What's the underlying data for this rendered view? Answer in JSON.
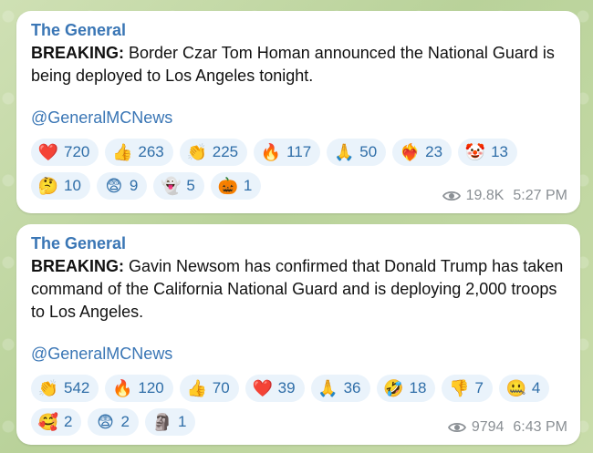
{
  "messages": [
    {
      "sender": "The General",
      "breaking_label": "BREAKING:",
      "body": " Border Czar Tom Homan announced the National Guard is being deployed to Los Angeles tonight.",
      "link": "@GeneralMCNews",
      "reactions": [
        {
          "emoji": "❤️",
          "icon": "red-heart-icon",
          "count": "720"
        },
        {
          "emoji": "👍",
          "icon": "thumbs-up-icon",
          "count": "263"
        },
        {
          "emoji": "👏",
          "icon": "clapping-hands-icon",
          "count": "225"
        },
        {
          "emoji": "🔥",
          "icon": "fire-icon",
          "count": "117"
        },
        {
          "emoji": "🙏",
          "icon": "praying-hands-icon",
          "count": "50"
        },
        {
          "emoji": "❤️‍🔥",
          "icon": "heart-on-fire-icon",
          "count": "23"
        },
        {
          "emoji": "🤡",
          "icon": "clown-face-icon",
          "count": "13"
        },
        {
          "emoji": "🤔",
          "icon": "thinking-face-icon",
          "count": "10"
        },
        {
          "emoji": "😨",
          "icon": "fearful-face-icon",
          "count": "9"
        },
        {
          "emoji": "👻",
          "icon": "ghost-icon",
          "count": "5"
        },
        {
          "emoji": "🎃",
          "icon": "jack-o-lantern-icon",
          "count": "1"
        }
      ],
      "views": "19.8K",
      "time": "5:27 PM"
    },
    {
      "sender": "The General",
      "breaking_label": "BREAKING:",
      "body": " Gavin Newsom has confirmed that Donald Trump has taken command of the California National Guard and is deploying 2,000 troops to Los Angeles.",
      "link": "@GeneralMCNews",
      "reactions": [
        {
          "emoji": "👏",
          "icon": "clapping-hands-icon",
          "count": "542"
        },
        {
          "emoji": "🔥",
          "icon": "fire-icon",
          "count": "120"
        },
        {
          "emoji": "👍",
          "icon": "thumbs-up-icon",
          "count": "70"
        },
        {
          "emoji": "❤️",
          "icon": "red-heart-icon",
          "count": "39"
        },
        {
          "emoji": "🙏",
          "icon": "praying-hands-icon",
          "count": "36"
        },
        {
          "emoji": "🤣",
          "icon": "rofl-face-icon",
          "count": "18"
        },
        {
          "emoji": "👎",
          "icon": "thumbs-down-icon",
          "count": "7"
        },
        {
          "emoji": "🤐",
          "icon": "zipper-mouth-face-icon",
          "count": "4"
        },
        {
          "emoji": "🥰",
          "icon": "smiling-face-with-hearts-icon",
          "count": "2"
        },
        {
          "emoji": "😨",
          "icon": "fearful-face-icon",
          "count": "2"
        },
        {
          "emoji": "🗿",
          "icon": "moai-icon",
          "count": "1"
        }
      ],
      "views": "9794",
      "time": "6:43 PM"
    }
  ]
}
